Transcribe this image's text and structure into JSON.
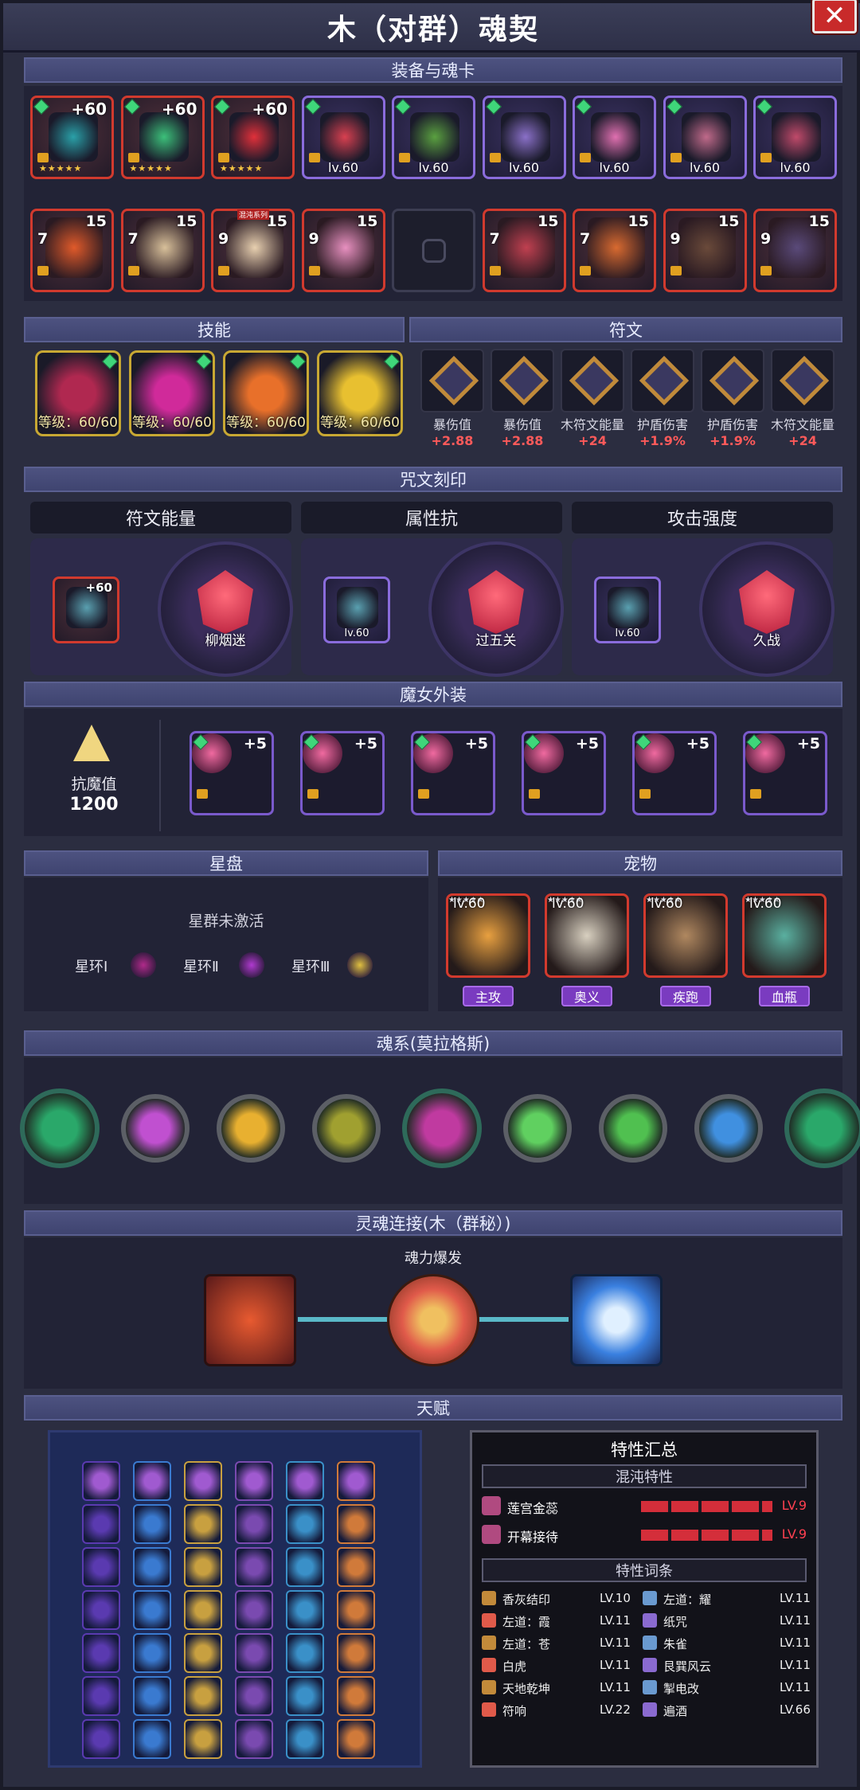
{
  "window": {
    "title": "木（对群）魂契",
    "close_label": "✕"
  },
  "sections": {
    "equip": "装备与魂卡",
    "skills": "技能",
    "runes": "符文",
    "engrave": "咒文刻印",
    "costume": "魔女外装",
    "starplate": "星盘",
    "pets": "宠物",
    "soul_system": "魂系(莫拉格斯)",
    "soul_link": "灵魂连接(木（群秘）)",
    "talent": "天赋"
  },
  "equipment": [
    {
      "label": "+60",
      "kind": "weapon",
      "color": "#2aa0a8"
    },
    {
      "label": "+60",
      "kind": "armor",
      "color": "#3cc07a"
    },
    {
      "label": "+60",
      "kind": "crystal",
      "color": "#e0303a"
    },
    {
      "label": "lv.60",
      "kind": "bow",
      "color": "#d84050"
    },
    {
      "label": "lv.60",
      "kind": "cloak",
      "color": "#5aa040"
    },
    {
      "label": "lv.60",
      "kind": "robe",
      "color": "#8a70c8"
    },
    {
      "label": "lv.60",
      "kind": "necklace",
      "color": "#e070b0"
    },
    {
      "label": "lv.60",
      "kind": "chest",
      "color": "#c06a8a"
    },
    {
      "label": "lv.60",
      "kind": "boot",
      "color": "#c04a6a"
    }
  ],
  "soul_cards": [
    {
      "top": "15",
      "left": "7",
      "color": "#e05a2a"
    },
    {
      "top": "15",
      "left": "7",
      "color": "#d8c09a"
    },
    {
      "top": "15",
      "left": "9",
      "color": "#e8d0b0",
      "badge": "混沌系列"
    },
    {
      "top": "15",
      "left": "9",
      "color": "#e890c0"
    },
    {
      "empty": true
    },
    {
      "top": "15",
      "left": "7",
      "color": "#c04050"
    },
    {
      "top": "15",
      "left": "7",
      "color": "#d86a30"
    },
    {
      "top": "15",
      "left": "9",
      "color": "#6a4a3a"
    },
    {
      "top": "15",
      "left": "9",
      "color": "#5a4a7a"
    }
  ],
  "skills": [
    {
      "label": "等级：60/60",
      "color": "#b02850"
    },
    {
      "label": "等级：60/60",
      "color": "#d02a9a"
    },
    {
      "label": "等级：60/60",
      "color": "#e8702a"
    },
    {
      "label": "等级：60/60",
      "color": "#e8c030"
    }
  ],
  "runes": [
    {
      "name": "暴伤值",
      "value": "+2.88"
    },
    {
      "name": "暴伤值",
      "value": "+2.88"
    },
    {
      "name": "木符文能量",
      "value": "+24"
    },
    {
      "name": "护盾伤害",
      "value": "+1.9%"
    },
    {
      "name": "护盾伤害",
      "value": "+1.9%"
    },
    {
      "name": "木符文能量",
      "value": "+24"
    }
  ],
  "engrave": [
    {
      "head": "符文能量",
      "item_label": "+60",
      "emblem": "柳烟迷"
    },
    {
      "head": "属性抗",
      "item_label": "lv.60",
      "emblem": "过五关"
    },
    {
      "head": "攻击强度",
      "item_label": "lv.60",
      "emblem": "久战"
    }
  ],
  "costume": {
    "resist_label": "抗魔值",
    "resist_value": "1200",
    "items": [
      {
        "plus": "+5",
        "kind": "horns"
      },
      {
        "plus": "+5",
        "kind": "ring"
      },
      {
        "plus": "+5",
        "kind": "heart"
      },
      {
        "plus": "+5",
        "kind": "collar"
      },
      {
        "plus": "+5",
        "kind": "earring"
      },
      {
        "plus": "+5",
        "kind": "pouch"
      }
    ]
  },
  "starplate": {
    "status": "星群未激活",
    "rings": [
      {
        "label": "星环Ⅰ",
        "icon": "bird-icon"
      },
      {
        "label": "星环Ⅱ",
        "icon": "moon-icon"
      },
      {
        "label": "星环Ⅲ",
        "icon": "sun-icon"
      }
    ]
  },
  "pets": [
    {
      "lvl": "lv.60",
      "tag": "主攻",
      "color": "#e8a040"
    },
    {
      "lvl": "lv.60",
      "tag": "奥义",
      "color": "#d8d0c0"
    },
    {
      "lvl": "lv.60",
      "tag": "疾跑",
      "color": "#b08860"
    },
    {
      "lvl": "lv.60",
      "tag": "血瓶",
      "color": "#5ab0a0"
    }
  ],
  "soul_orbs": [
    {
      "color": "#2aa86a"
    },
    {
      "color": "#c050d0"
    },
    {
      "color": "#e8b030"
    },
    {
      "color": "#a0a030"
    },
    {
      "color": "#c03aa0"
    },
    {
      "color": "#60d060"
    },
    {
      "color": "#50c050"
    },
    {
      "color": "#4090e0"
    },
    {
      "color": "#2aa86a"
    }
  ],
  "soul_link": {
    "caption": "魂力爆发"
  },
  "summary": {
    "title": "特性汇总",
    "chaos_head": "混沌特性",
    "chaos": [
      {
        "name": "莲宫金蕊",
        "level": "LV.9"
      },
      {
        "name": "开幕接待",
        "level": "LV.9"
      }
    ],
    "traits_head": "特性词条",
    "traits": [
      {
        "name": "香灰结印",
        "level": "LV.10"
      },
      {
        "name": "左道：耀",
        "level": "LV.11"
      },
      {
        "name": "左道：霞",
        "level": "LV.11"
      },
      {
        "name": "纸咒",
        "level": "LV.11"
      },
      {
        "name": "左道：苍",
        "level": "LV.11"
      },
      {
        "name": "朱雀",
        "level": "LV.11"
      },
      {
        "name": "白虎",
        "level": "LV.11"
      },
      {
        "name": "艮巽风云",
        "level": "LV.11"
      },
      {
        "name": "天地乾坤",
        "level": "LV.11"
      },
      {
        "name": "掣电改",
        "level": "LV.11"
      },
      {
        "name": "符响",
        "level": "LV.22"
      },
      {
        "name": "遍酒",
        "level": "LV.66"
      }
    ]
  }
}
